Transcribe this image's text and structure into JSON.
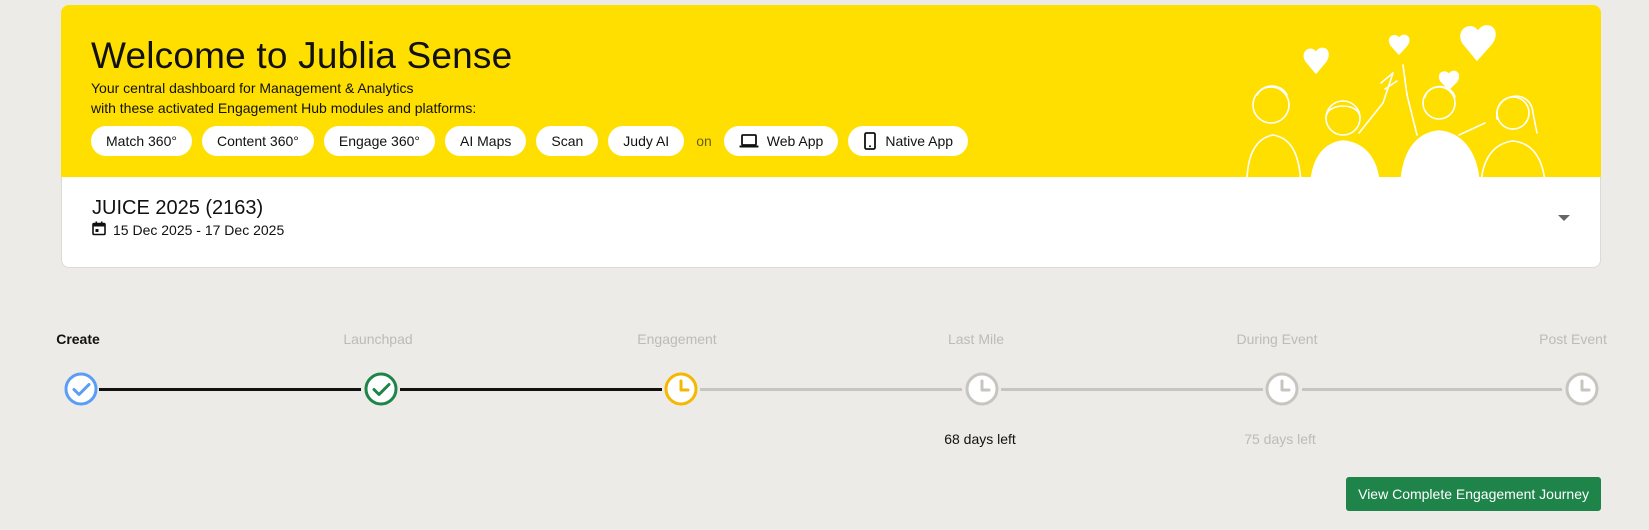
{
  "banner": {
    "title": "Welcome to Jublia Sense",
    "subtitle_line1": "Your central dashboard for Management & Analytics",
    "subtitle_line2": "with these activated Engagement Hub modules and platforms:",
    "modules": [
      "Match 360°",
      "Content 360°",
      "Engage 360°",
      "AI Maps",
      "Scan",
      "Judy AI"
    ],
    "on_label": "on",
    "platforms": [
      {
        "label": "Web App",
        "icon": "laptop-icon"
      },
      {
        "label": "Native App",
        "icon": "smartphone-icon"
      }
    ],
    "background_color": "#ffdf00"
  },
  "event": {
    "name": "JUICE 2025 (2163)",
    "dates": "15 Dec 2025 - 17 Dec 2025",
    "date_icon": "calendar-icon",
    "toggle_icon": "caret-down-icon"
  },
  "timeline": {
    "steps": [
      {
        "label": "Create",
        "status": "completed-current",
        "icon": "check-circle-icon"
      },
      {
        "label": "Launchpad",
        "status": "completed",
        "icon": "check-circle-icon"
      },
      {
        "label": "Engagement",
        "status": "in-progress",
        "icon": "clock-icon"
      },
      {
        "label": "Last Mile",
        "status": "pending",
        "icon": "clock-icon"
      },
      {
        "label": "During Event",
        "status": "pending",
        "icon": "clock-icon"
      },
      {
        "label": "Post Event",
        "status": "pending",
        "icon": "clock-icon"
      }
    ],
    "countdowns": [
      {
        "step": "Last Mile",
        "text": "68 days left"
      },
      {
        "step": "During Event",
        "text": "75 days left"
      }
    ],
    "colors": {
      "create": "#5b9df5",
      "completed": "#1e8449",
      "in_progress": "#f5b800",
      "pending": "#c7c5c0"
    }
  },
  "actions": {
    "view_journey": "View Complete Engagement Journey",
    "button_color": "#1e8449"
  }
}
